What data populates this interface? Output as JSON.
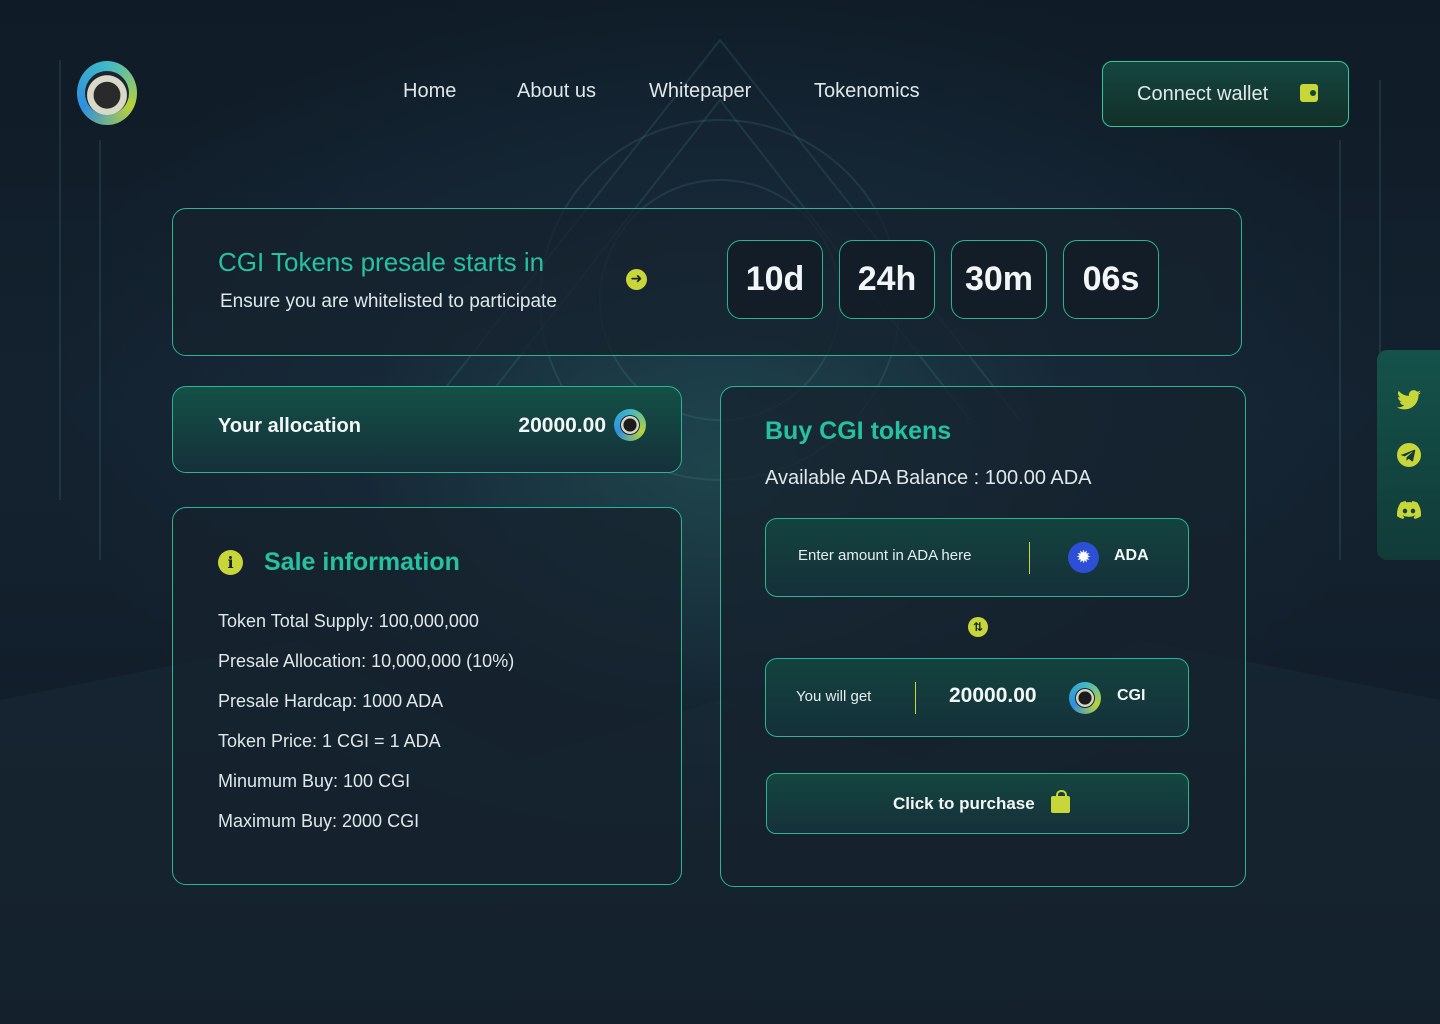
{
  "header": {
    "nav": [
      {
        "label": "Home"
      },
      {
        "label": "About us"
      },
      {
        "label": "Whitepaper"
      },
      {
        "label": "Tokenomics"
      }
    ],
    "connect_wallet_label": "Connect wallet"
  },
  "countdown": {
    "title": "CGI Tokens presale starts in",
    "subtitle": "Ensure you are whitelisted to participate",
    "days": "10d",
    "hours": "24h",
    "minutes": "30m",
    "seconds": "06s"
  },
  "allocation": {
    "label": "Your allocation",
    "value": "20000.00"
  },
  "sale_info": {
    "title": "Sale information",
    "rows": [
      "Token Total Supply: 100,000,000",
      "Presale Allocation: 10,000,000 (10%)",
      "Presale Hardcap: 1000 ADA",
      "Token Price: 1 CGI = 1 ADA",
      "Minumum Buy: 100 CGI",
      "Maximum Buy: 2000 CGI"
    ]
  },
  "buy": {
    "title": "Buy CGI tokens",
    "balance": "Available ADA Balance : 100.00 ADA",
    "ada_placeholder": "Enter amount in ADA here",
    "ada_unit": "ADA",
    "get_label": "You will get",
    "get_value": "20000.00",
    "get_unit": "CGI",
    "purchase_label": "Click to purchase"
  },
  "social": {
    "icons": [
      "twitter-icon",
      "telegram-icon",
      "discord-icon"
    ]
  },
  "colors": {
    "accent": "#27c0a0",
    "highlight": "#c8d63a",
    "border": "#2bb394",
    "background": "#101a24"
  }
}
